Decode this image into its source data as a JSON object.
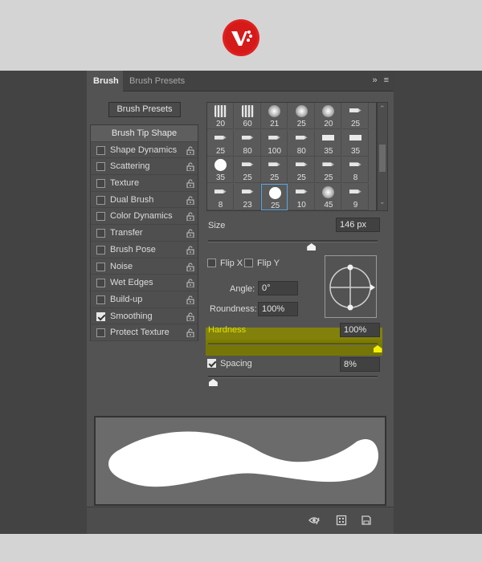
{
  "tabs": [
    {
      "label": "Brush",
      "active": true
    },
    {
      "label": "Brush Presets",
      "active": false
    }
  ],
  "header_icons": [
    "double-chevron-right-icon",
    "hamburger-menu-icon"
  ],
  "brush_presets_button": "Brush Presets",
  "options": [
    {
      "label": "Brush Tip Shape",
      "checkbox": false,
      "lock": false
    },
    {
      "label": "Shape Dynamics",
      "checked": false
    },
    {
      "label": "Scattering",
      "checked": false
    },
    {
      "label": "Texture",
      "checked": false
    },
    {
      "label": "Dual Brush",
      "checked": false
    },
    {
      "label": "Color Dynamics",
      "checked": false
    },
    {
      "label": "Transfer",
      "checked": false
    },
    {
      "label": "Brush Pose",
      "checked": false
    },
    {
      "label": "Noise",
      "checked": false
    },
    {
      "label": "Wet Edges",
      "checked": false
    },
    {
      "label": "Build-up",
      "checked": false
    },
    {
      "label": "Smoothing",
      "checked": true
    },
    {
      "label": "Protect Texture",
      "checked": false
    }
  ],
  "brush_tips": [
    {
      "size": "20",
      "style": "texture"
    },
    {
      "size": "60",
      "style": "texture"
    },
    {
      "size": "21",
      "style": "soft"
    },
    {
      "size": "25",
      "style": "soft"
    },
    {
      "size": "20",
      "style": "soft"
    },
    {
      "size": "25",
      "style": "pen"
    },
    {
      "size": "25",
      "style": "pen"
    },
    {
      "size": "80",
      "style": "pen"
    },
    {
      "size": "100",
      "style": "pen"
    },
    {
      "size": "80",
      "style": "pen"
    },
    {
      "size": "35",
      "style": "chisel"
    },
    {
      "size": "35",
      "style": "chisel"
    },
    {
      "size": "35",
      "style": "hard"
    },
    {
      "size": "25",
      "style": "pen"
    },
    {
      "size": "25",
      "style": "pen"
    },
    {
      "size": "25",
      "style": "pen"
    },
    {
      "size": "25",
      "style": "pen"
    },
    {
      "size": "8",
      "style": "pen"
    },
    {
      "size": "8",
      "style": "pen"
    },
    {
      "size": "23",
      "style": "pen"
    },
    {
      "size": "25",
      "style": "hard",
      "selected": true
    },
    {
      "size": "10",
      "style": "pen"
    },
    {
      "size": "45",
      "style": "soft"
    },
    {
      "size": "9",
      "style": "pen"
    }
  ],
  "size": {
    "label": "Size",
    "value": "146 px",
    "fraction": 0.61
  },
  "flip_x": {
    "label": "Flip X",
    "checked": false
  },
  "flip_y": {
    "label": "Flip Y",
    "checked": false
  },
  "angle": {
    "label": "Angle:",
    "value": "0°"
  },
  "roundness": {
    "label": "Roundness:",
    "value": "100%"
  },
  "hardness": {
    "label": "Hardness",
    "value": "100%",
    "fraction": 1.0,
    "highlight_color": "#c8c800"
  },
  "spacing": {
    "label": "Spacing",
    "value": "8%",
    "checked": true,
    "fraction": 0.03
  },
  "bottom_icons": [
    "eye-toggle-icon",
    "grid-icon",
    "new-preset-icon"
  ],
  "colors": {
    "panel": "#535353",
    "highlight": "#8a8a00",
    "logo_red": "#e02020"
  }
}
